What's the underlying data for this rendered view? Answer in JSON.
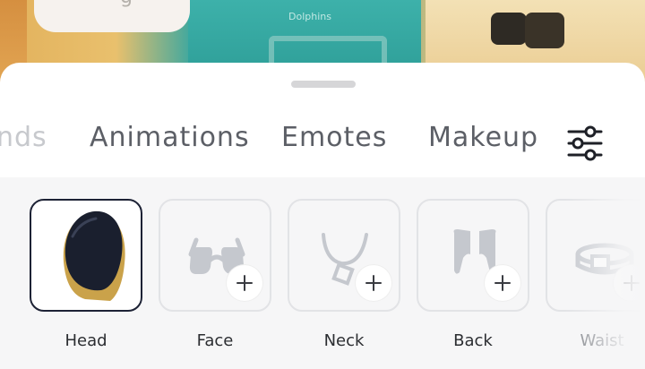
{
  "tabs": [
    {
      "label": "nds",
      "state": "partial"
    },
    {
      "label": "Animations"
    },
    {
      "label": "Emotes"
    },
    {
      "label": "Makeup"
    }
  ],
  "filter_icon": "sliders-icon",
  "background": {
    "jersey_text": "Dolphins"
  },
  "slots": [
    {
      "label": "Head",
      "selected": true,
      "icon": "black-helmet-item"
    },
    {
      "label": "Face",
      "selected": false,
      "icon": "glasses-icon"
    },
    {
      "label": "Neck",
      "selected": false,
      "icon": "necklace-icon"
    },
    {
      "label": "Back",
      "selected": false,
      "icon": "wings-icon"
    },
    {
      "label": "Waist",
      "selected": false,
      "icon": "belt-icon"
    }
  ],
  "colors": {
    "selected_border": "#1d2235",
    "tab_text": "#5c5f66",
    "icon_gray": "#c5c8ce"
  }
}
